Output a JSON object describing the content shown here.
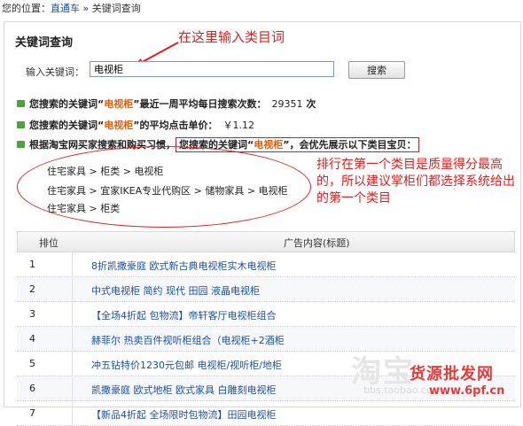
{
  "breadcrumb": {
    "prefix": "您的位置：",
    "link": "直通车",
    "sep": "»",
    "current": "关键词查询"
  },
  "panel": {
    "title": "关键词查询"
  },
  "annotation_input": "在这里输入类目词",
  "search": {
    "label": "输入关键词：",
    "value": "电视柜",
    "button": "搜索"
  },
  "stats": {
    "s1_pre": "您搜索的关键词“",
    "s1_kw": "电视柜",
    "s1_post": "”最近一周平均每日搜索次数：",
    "s1_val": "29351",
    "s1_unit": "次",
    "s2_pre": "您搜索的关键词“",
    "s2_kw": "电视柜",
    "s2_post": "”的平均点击单价：",
    "s2_val": "￥1.12",
    "s3_pre": "根据淘宝网买家搜索和购买习惯，",
    "s3_box_pre": "您搜索的关键词“",
    "s3_kw": "电视柜",
    "s3_box_post": "”，会优先展示以下类目宝贝："
  },
  "categories": [
    "住宅家具 > 柜类 > 电视柜",
    "住宅家具 > 宜家IKEA专业代购区 > 储物家具 > 电视柜",
    "住宅家具 > 柜类"
  ],
  "annotation_category": "排行在第一个类目是质量得分最高的，所以建议掌柜们都选择系统给出的第一个类目",
  "table": {
    "headers": [
      "排位",
      "广告内容(标题)"
    ],
    "rows": [
      {
        "rank": "1",
        "title": "8折凯撒豪庭 欧式新古典电视柜实木电视柜"
      },
      {
        "rank": "2",
        "title": "中式电视柜 简约 现代 田园 液晶电视柜"
      },
      {
        "rank": "3",
        "title": "【全场4折起 包物流】帝轩客厅电视柜组合"
      },
      {
        "rank": "4",
        "title": "赫菲尔 热卖百件视听柜组合（电视柜+2酒柜"
      },
      {
        "rank": "5",
        "title": "冲五钻特价1230元包邮 电视柜/视听柜/地柜"
      },
      {
        "rank": "6",
        "title": "凯撒豪庭 欧式地柜 欧式家具 白雕刻电视柜"
      },
      {
        "rank": "7",
        "title": "【新品4折起 全场限时包物流】田园电视柜"
      }
    ]
  },
  "watermark": {
    "logo": "淘宝",
    "url": "bbs.taobao.com",
    "site_cn": "货源批发网",
    "site_url": "www.6pf.cn"
  }
}
